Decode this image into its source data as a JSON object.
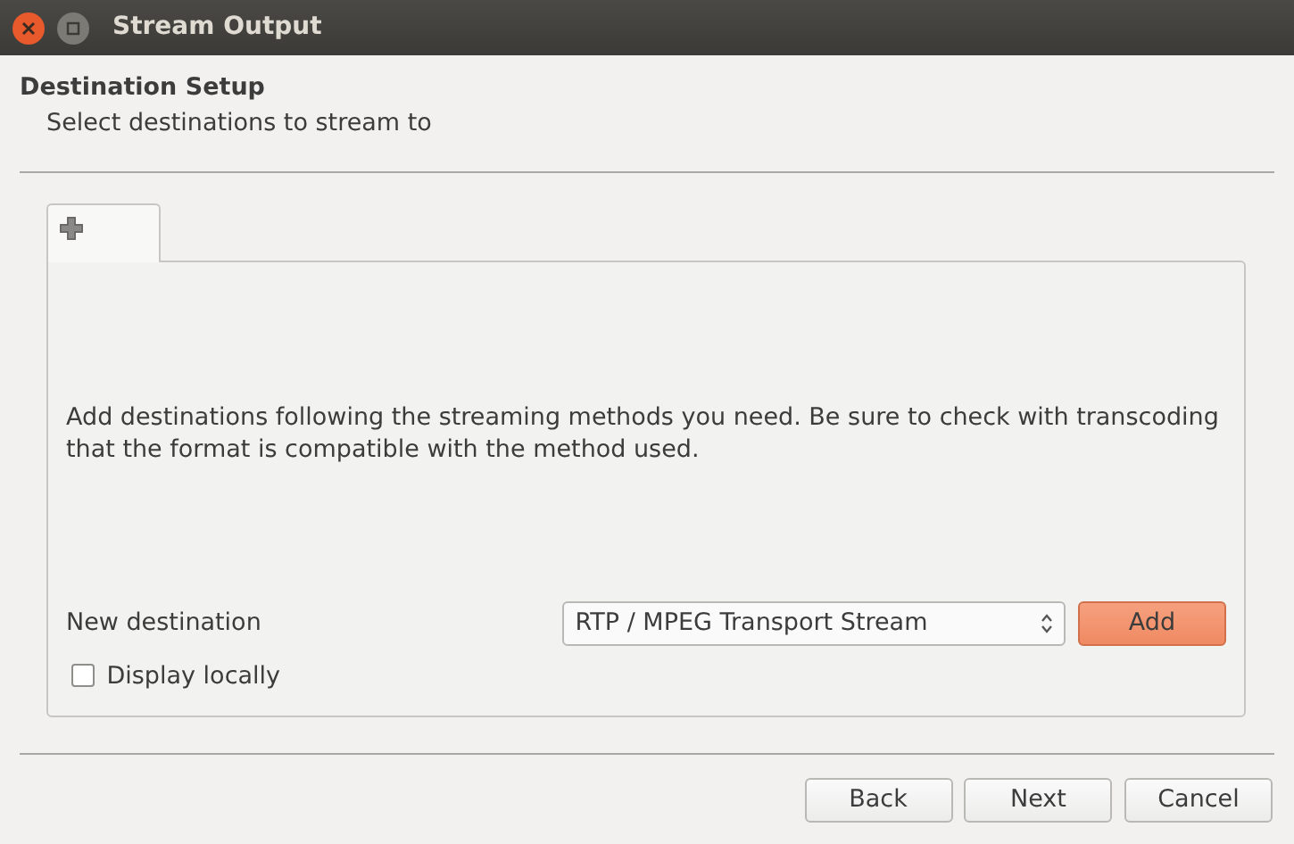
{
  "window": {
    "title": "Stream Output"
  },
  "header": {
    "title": "Destination Setup",
    "subtitle": "Select destinations to stream to"
  },
  "tabs": [
    {
      "kind": "add",
      "selected": true
    }
  ],
  "panel": {
    "description": "Add destinations following the streaming methods you need. Be sure to check with transcoding that the format is compatible with the method used.",
    "new_destination_label": "New destination",
    "method": "RTP / MPEG Transport Stream",
    "add_button": "Add",
    "display_locally": {
      "label": "Display locally",
      "checked": false
    }
  },
  "buttons": [
    "Back",
    "Next",
    "Cancel"
  ]
}
